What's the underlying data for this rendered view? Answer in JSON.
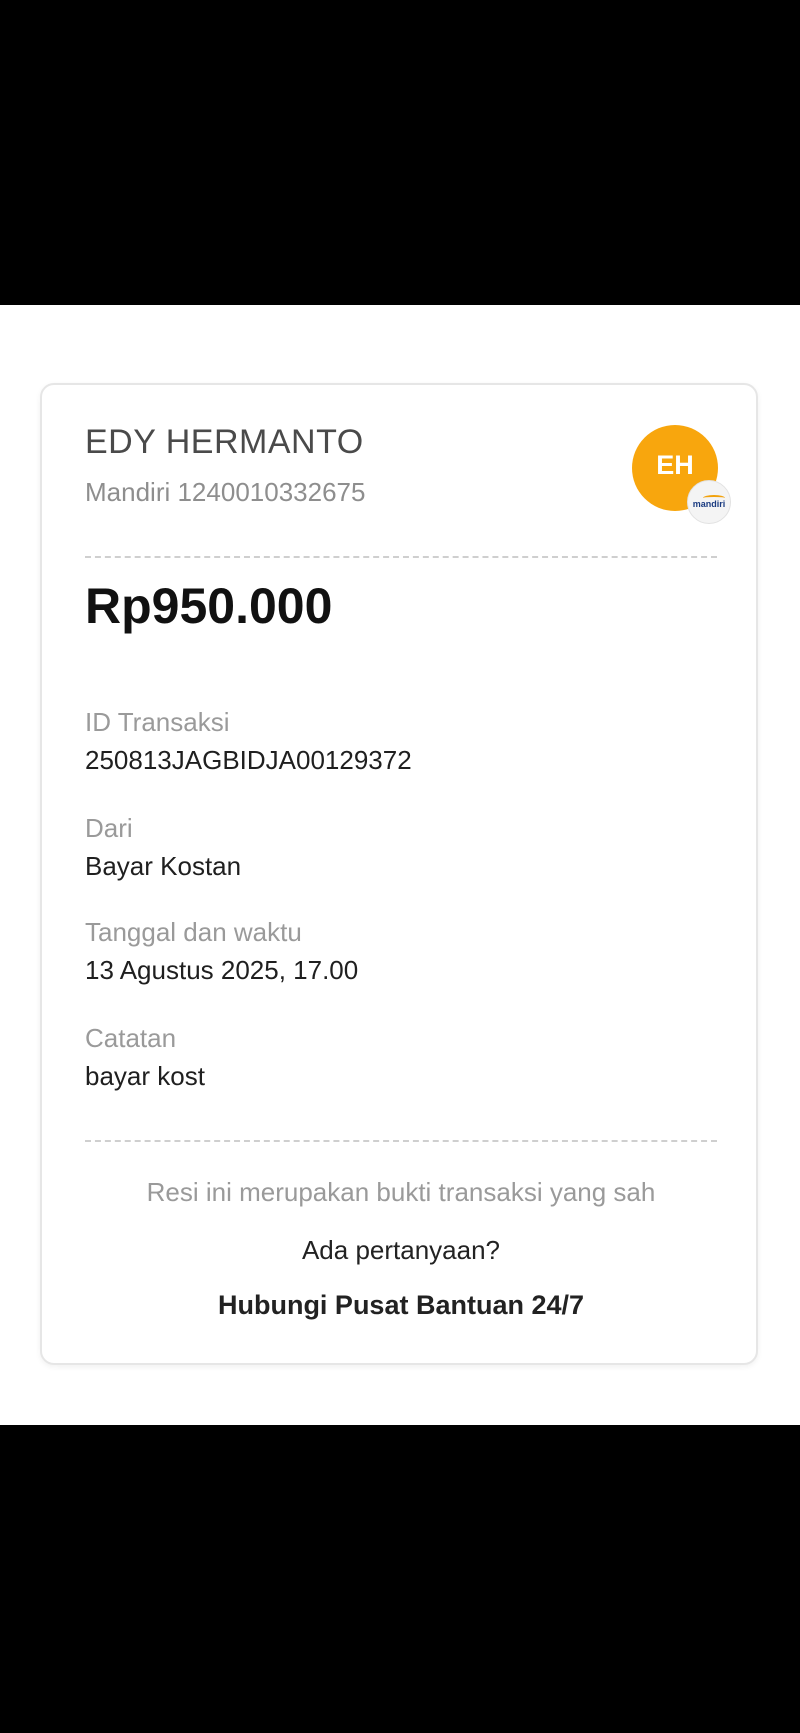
{
  "receipt": {
    "recipient_name": "EDY HERMANTO",
    "recipient_account": "Mandiri 1240010332675",
    "avatar_initials": "EH",
    "bank_logo_text": "mandiri",
    "amount": "Rp950.000",
    "fields": [
      {
        "label": "ID Transaksi",
        "value": "250813JAGBIDJA00129372"
      },
      {
        "label": "Dari",
        "value": "Bayar Kostan"
      },
      {
        "label": "Tanggal dan waktu",
        "value": "13 Agustus 2025, 17.00"
      },
      {
        "label": "Catatan",
        "value": "bayar kost"
      }
    ],
    "footer_note": "Resi ini merupakan bukti transaksi yang sah",
    "question": "Ada pertanyaan?",
    "help_link": "Hubungi Pusat Bantuan 24/7"
  },
  "colors": {
    "accent_avatar": "#f8a60d",
    "amount_text": "#111111",
    "muted_text": "#9a9a9a"
  }
}
